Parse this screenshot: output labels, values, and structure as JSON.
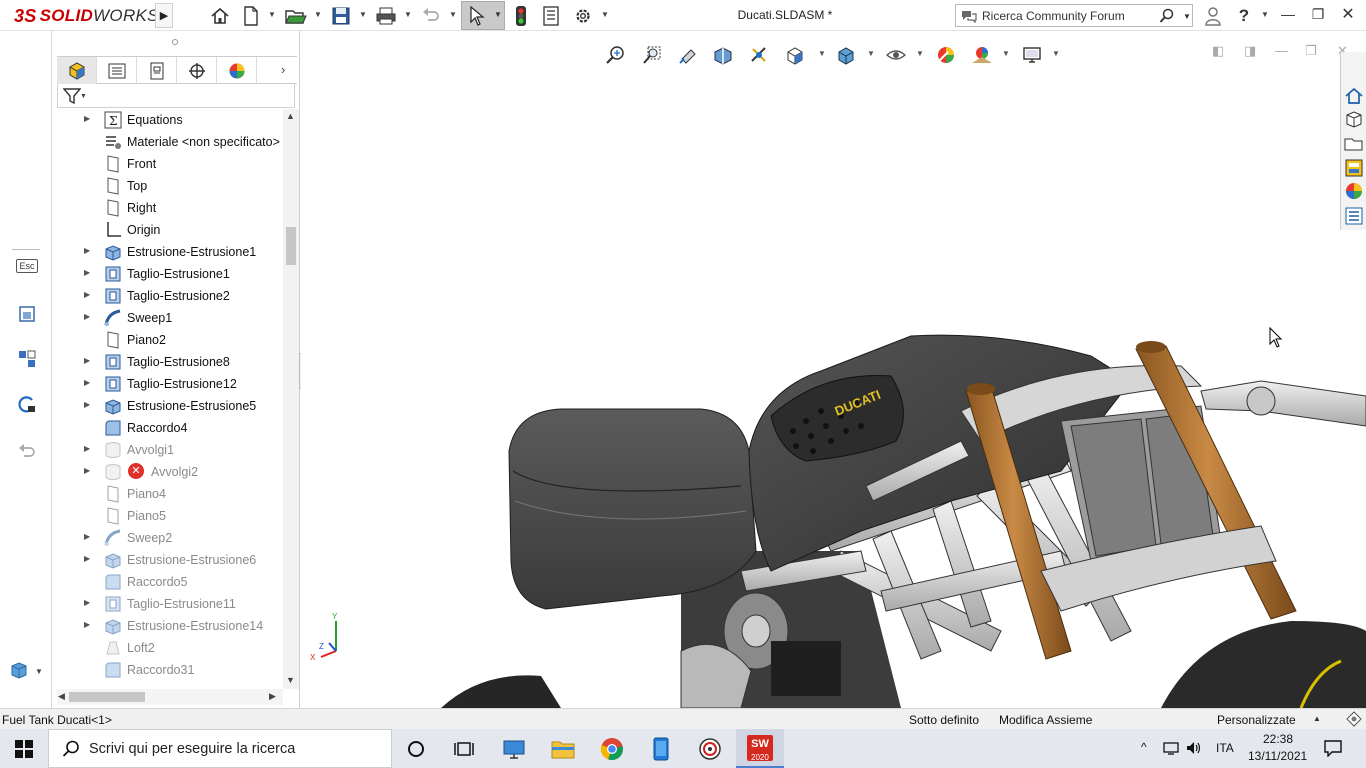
{
  "app": {
    "logo_ds": "3S",
    "logo_solid": "SOLID",
    "logo_works": "WORKS"
  },
  "titlebar": {
    "document_title": "Ducati.SLDASM *",
    "search_placeholder": "Ricerca Community Forum"
  },
  "feature_tree": {
    "items": [
      {
        "label": "Equations",
        "expandable": true,
        "icon": "equations-icon",
        "dim": false
      },
      {
        "label": "Materiale <non specificato>",
        "expandable": false,
        "icon": "material-icon",
        "dim": false
      },
      {
        "label": "Front",
        "expandable": false,
        "icon": "plane-icon",
        "dim": false
      },
      {
        "label": "Top",
        "expandable": false,
        "icon": "plane-icon",
        "dim": false
      },
      {
        "label": "Right",
        "expandable": false,
        "icon": "plane-icon",
        "dim": false
      },
      {
        "label": "Origin",
        "expandable": false,
        "icon": "origin-icon",
        "dim": false
      },
      {
        "label": "Estrusione-Estrusione1",
        "expandable": true,
        "icon": "extrude-icon",
        "dim": false
      },
      {
        "label": "Taglio-Estrusione1",
        "expandable": true,
        "icon": "cut-extrude-icon",
        "dim": false
      },
      {
        "label": "Taglio-Estrusione2",
        "expandable": true,
        "icon": "cut-extrude-icon",
        "dim": false
      },
      {
        "label": "Sweep1",
        "expandable": true,
        "icon": "sweep-icon",
        "dim": false
      },
      {
        "label": "Piano2",
        "expandable": false,
        "icon": "plane-icon",
        "dim": false
      },
      {
        "label": "Taglio-Estrusione8",
        "expandable": true,
        "icon": "cut-extrude-icon",
        "dim": false
      },
      {
        "label": "Taglio-Estrusione12",
        "expandable": true,
        "icon": "cut-extrude-icon",
        "dim": false
      },
      {
        "label": "Estrusione-Estrusione5",
        "expandable": true,
        "icon": "extrude-icon",
        "dim": false
      },
      {
        "label": "Raccordo4",
        "expandable": false,
        "icon": "fillet-icon",
        "dim": false
      },
      {
        "label": "Avvolgi1",
        "expandable": true,
        "icon": "wrap-icon",
        "dim": true
      },
      {
        "label": "Avvolgi2",
        "expandable": true,
        "icon": "wrap-icon",
        "dim": true,
        "error": true
      },
      {
        "label": "Piano4",
        "expandable": false,
        "icon": "plane-icon",
        "dim": true
      },
      {
        "label": "Piano5",
        "expandable": false,
        "icon": "plane-icon",
        "dim": true
      },
      {
        "label": "Sweep2",
        "expandable": true,
        "icon": "sweep-icon",
        "dim": true
      },
      {
        "label": "Estrusione-Estrusione6",
        "expandable": true,
        "icon": "extrude-icon",
        "dim": true
      },
      {
        "label": "Raccordo5",
        "expandable": false,
        "icon": "fillet-icon",
        "dim": true
      },
      {
        "label": "Taglio-Estrusione11",
        "expandable": true,
        "icon": "cut-extrude-icon",
        "dim": true
      },
      {
        "label": "Estrusione-Estrusione14",
        "expandable": true,
        "icon": "extrude-icon",
        "dim": true
      },
      {
        "label": "Loft2",
        "expandable": false,
        "icon": "loft-icon",
        "dim": true
      },
      {
        "label": "Raccordo31",
        "expandable": false,
        "icon": "fillet-icon",
        "dim": true
      }
    ]
  },
  "left_strip": {
    "esc_label": "Esc"
  },
  "viewport": {
    "decal_text": "DUCATI",
    "triad_y": "Y",
    "triad_x": "X",
    "triad_z": "Z"
  },
  "statusbar": {
    "selection": "Fuel Tank Ducati<1>",
    "definition": "Sotto definito",
    "mode": "Modifica Assieme",
    "units": "Personalizzate"
  },
  "taskbar": {
    "search_placeholder": "Scrivi qui per eseguire la ricerca",
    "sw_badge": "2020",
    "language": "ITA",
    "time": "22:38",
    "date": "13/11/2021"
  },
  "colors": {
    "brand_red": "#d5281e",
    "accent_blue": "#1e6fd1",
    "fork_orange": "#b5722c"
  }
}
